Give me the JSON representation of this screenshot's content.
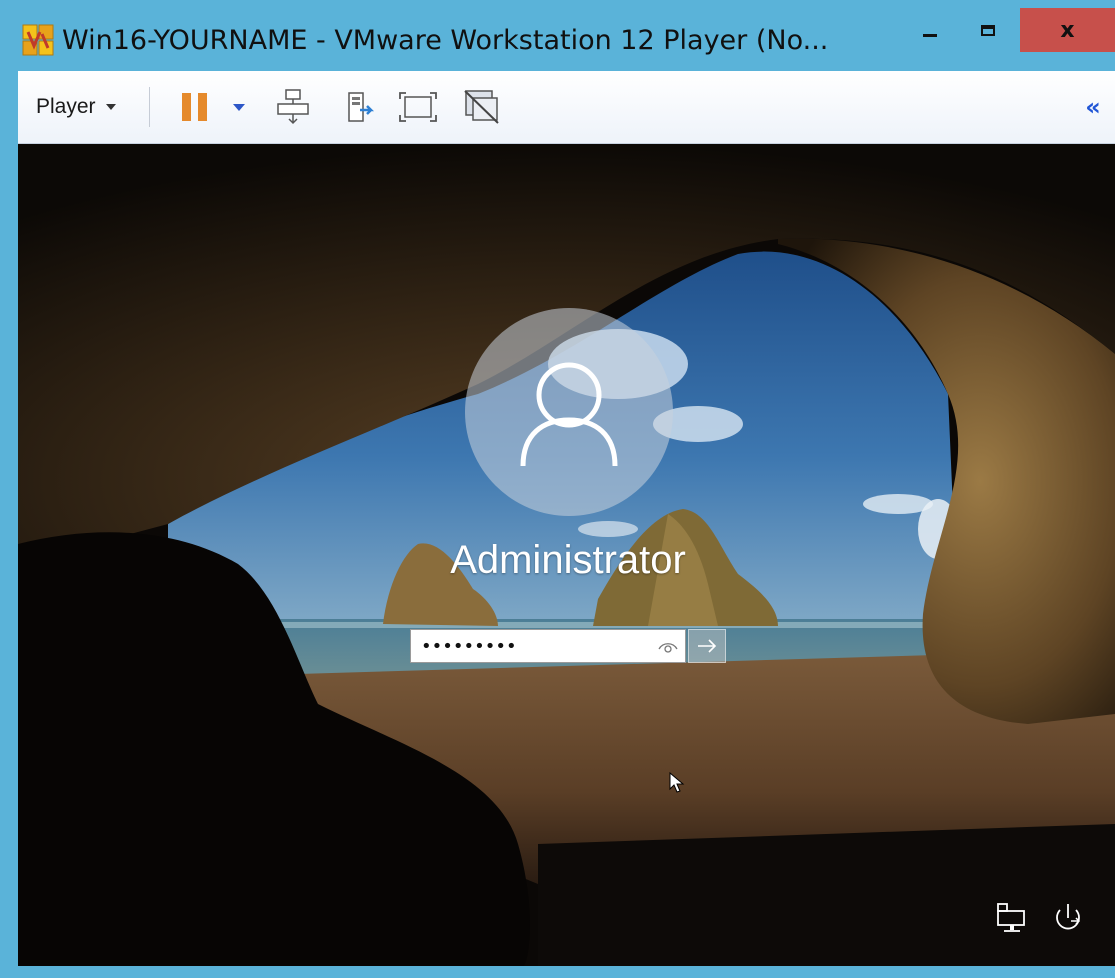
{
  "window": {
    "title": "Win16-YOURNAME - VMware Workstation 12 Player (No...",
    "close_glyph": "x"
  },
  "toolbar": {
    "player_label": "Player",
    "icons": [
      "pause-icon",
      "dropdown-caret-icon",
      "network-adapter-icon",
      "removable-device-icon",
      "fullscreen-icon",
      "unity-icon",
      "collapse-chevrons-icon"
    ]
  },
  "login": {
    "user_name": "Administrator",
    "password_masked": "•••••••••"
  },
  "colors": {
    "titlebar": "#5ab3d9",
    "close_button": "#c7504b",
    "pause_icon": "#e58a2c",
    "collapse_icon": "#2156d6"
  }
}
